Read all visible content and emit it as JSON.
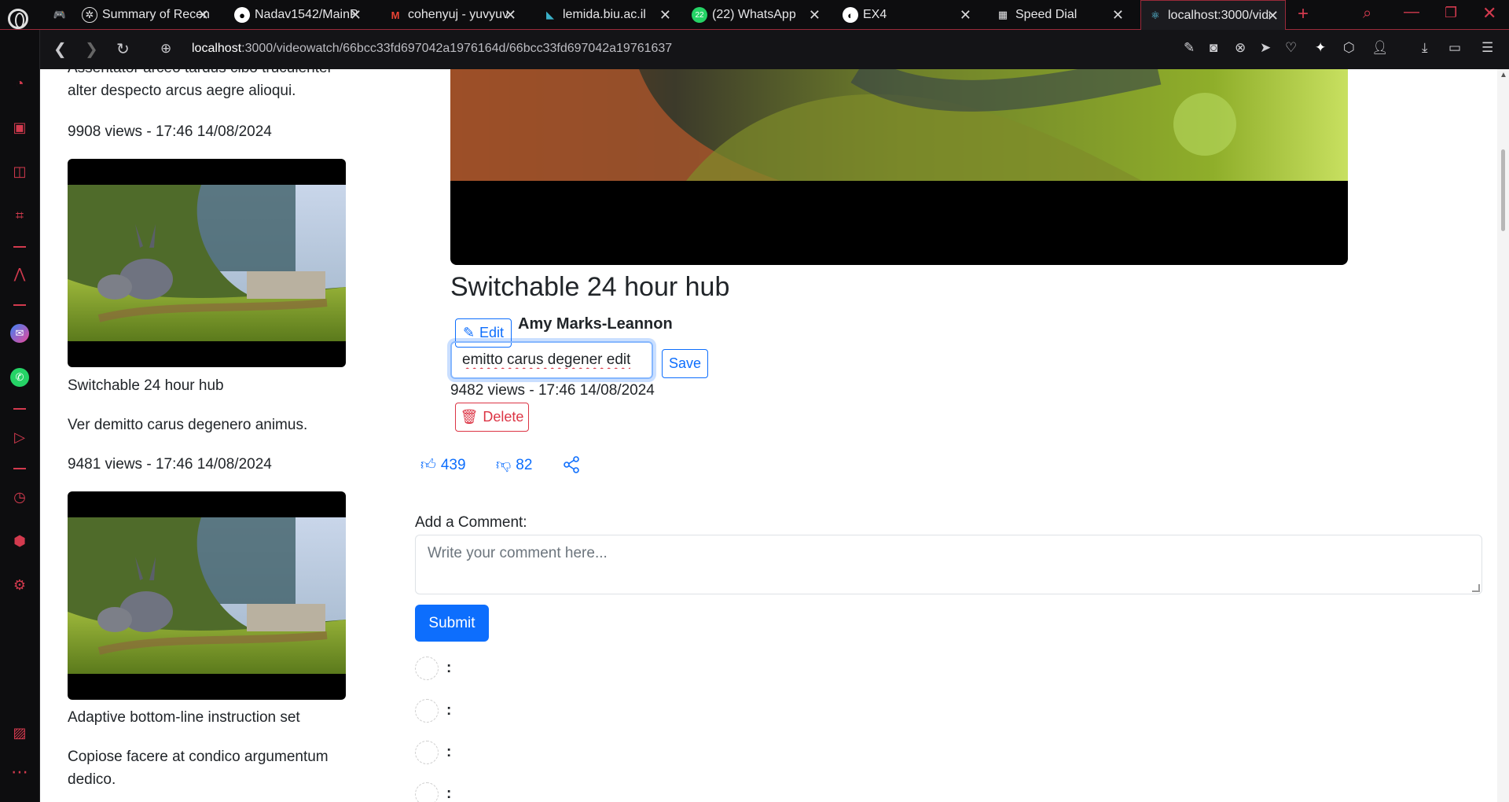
{
  "browser": {
    "tabs": [
      {
        "title": "Summary of Recen",
        "icon": "openai-icon"
      },
      {
        "title": "Nadav1542/MainP",
        "icon": "github-icon"
      },
      {
        "title": "cohenyuj - yuvyuv",
        "icon": "gmail-icon"
      },
      {
        "title": "lemida.biu.ac.il",
        "icon": "moodle-icon"
      },
      {
        "title": "(22) WhatsApp",
        "icon": "whatsapp-icon"
      },
      {
        "title": "EX4",
        "icon": "globe-icon"
      },
      {
        "title": "Speed Dial",
        "icon": "grid-icon"
      },
      {
        "title": "localhost:3000/vide",
        "icon": "react-icon"
      }
    ],
    "url_host": "localhost",
    "url_rest": ":3000/videowatch/66bcc33fd697042a1976164d/66bcc33fd697042a19761637",
    "whatsapp_badge": "22"
  },
  "related": {
    "top_desc": "Assentator arceo tardus cibo truculenter alter despecto arcus aegre alioqui.",
    "top_views": "9908 views - 17:46 14/08/2024",
    "items": [
      {
        "title": "Switchable 24 hour hub",
        "desc": "Ver demitto carus degenero animus.",
        "views": "9481 views - 17:46 14/08/2024"
      },
      {
        "title": "Adaptive bottom-line instruction set",
        "desc": "Copiose facere at condico argumentum dedico."
      }
    ]
  },
  "video": {
    "title": "Switchable 24 hour hub",
    "edit_label": "Edit",
    "author": "Amy Marks-Leannon",
    "edit_value": "emitto carus degener edit",
    "save_label": "Save",
    "views": "9482 views - 17:46 14/08/2024",
    "delete_label": "Delete",
    "likes": "439",
    "dislikes": "82"
  },
  "comments": {
    "label": "Add a Comment:",
    "placeholder": "Write your comment here...",
    "submit_label": "Submit",
    "rows": [
      ":",
      ":",
      ":",
      ":"
    ]
  },
  "colors": {
    "accent": "#0d6efd",
    "danger": "#dc3545",
    "browser_accent": "#d23a4e"
  }
}
